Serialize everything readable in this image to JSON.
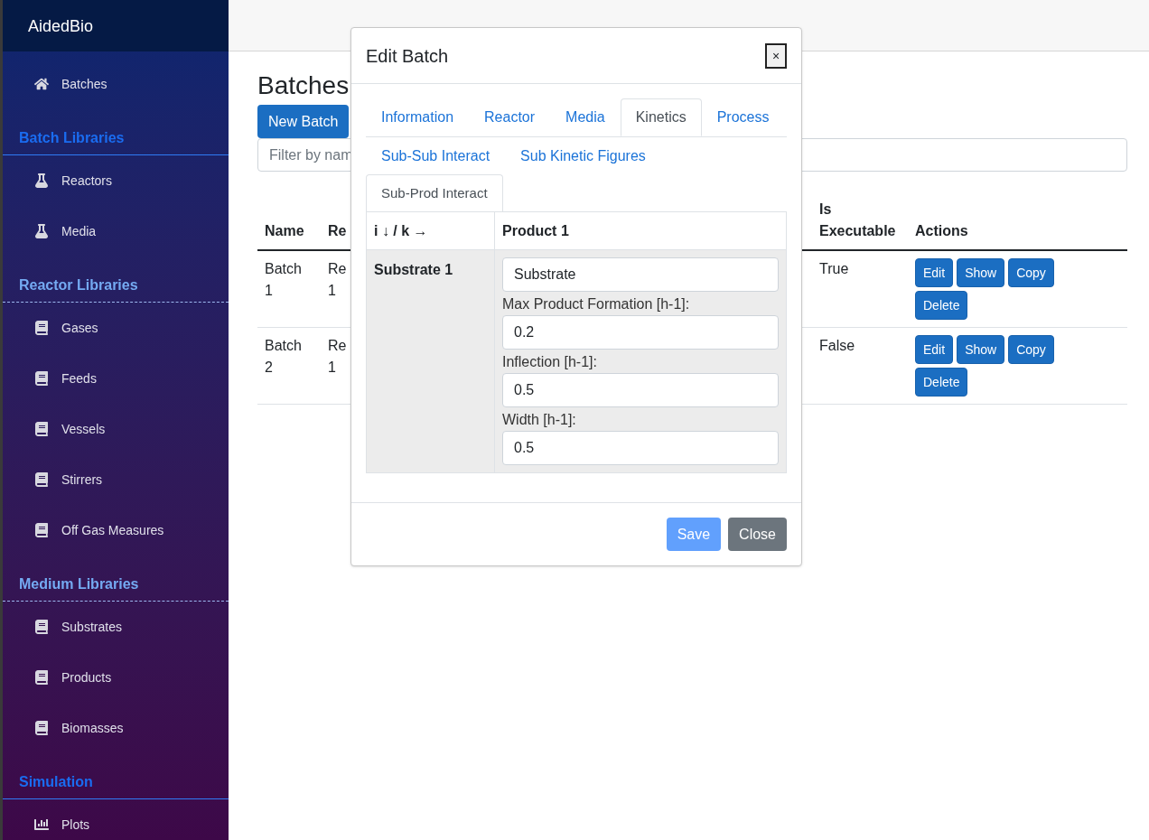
{
  "brand": "AidedBio",
  "sidebar": {
    "items": [
      {
        "kind": "home",
        "label": "Batches"
      },
      {
        "kind": "heading",
        "label": "Batch Libraries",
        "color": "#1a6cf0"
      },
      {
        "kind": "flask",
        "label": "Reactors"
      },
      {
        "kind": "flask",
        "label": "Media"
      },
      {
        "kind": "subheading",
        "label": "Reactor Libraries",
        "color": "#74aaf2"
      },
      {
        "kind": "book",
        "label": "Gases"
      },
      {
        "kind": "book",
        "label": "Feeds"
      },
      {
        "kind": "book",
        "label": "Vessels"
      },
      {
        "kind": "book",
        "label": "Stirrers"
      },
      {
        "kind": "book",
        "label": "Off Gas Measures"
      },
      {
        "kind": "subheading",
        "label": "Medium Libraries",
        "color": "#74aaf2"
      },
      {
        "kind": "book",
        "label": "Substrates"
      },
      {
        "kind": "book",
        "label": "Products"
      },
      {
        "kind": "book",
        "label": "Biomasses"
      },
      {
        "kind": "heading",
        "label": "Simulation",
        "color": "#1a6cf0"
      },
      {
        "kind": "chart",
        "label": "Plots"
      }
    ]
  },
  "page": {
    "title": "Batches",
    "new_button": "New Batch",
    "filter": {
      "placeholder": "Filter by nam"
    },
    "table": {
      "columns": [
        "Name",
        "Re",
        "Is Executable",
        "Actions"
      ],
      "rows": [
        {
          "cells": [
            "Batch 1",
            "Re 1",
            "True"
          ],
          "actions": [
            "Edit",
            "Show",
            "Copy",
            "Delete"
          ]
        },
        {
          "cells": [
            "Batch 2",
            "Re 1",
            "False"
          ],
          "actions": [
            "Edit",
            "Show",
            "Copy",
            "Delete"
          ]
        }
      ]
    }
  },
  "modal": {
    "title": "Edit Batch",
    "close": "×",
    "tabs": [
      {
        "label": "Information",
        "selected": false
      },
      {
        "label": "Reactor",
        "selected": false
      },
      {
        "label": "Media",
        "selected": false
      },
      {
        "label": "Kinetics",
        "selected": true
      },
      {
        "label": "Process",
        "selected": false
      }
    ],
    "sub_tabs": [
      {
        "label": "Sub-Sub Interact",
        "selected": false
      },
      {
        "label": "Sub Kinetic Figures",
        "selected": false
      },
      {
        "label": "Sub-Prod Interact",
        "selected": true
      }
    ],
    "table": {
      "corner": "i ↓ / k →",
      "columns": [
        "Product 1"
      ],
      "rows": [
        {
          "header": "Substrate 1",
          "cells": [
            {
              "select": "Substrate",
              "fields": [
                {
                  "label": "Max Product Formation [h-1]:",
                  "value": "0.2"
                },
                {
                  "label": "Inflection [h-1]:",
                  "value": "0.5"
                },
                {
                  "label": "Width [h-1]:",
                  "value": "0.5"
                }
              ]
            }
          ]
        }
      ]
    },
    "buttons": [
      {
        "kind": "primary",
        "label": "Save",
        "disabled": true
      },
      {
        "kind": "secondary",
        "label": "Close",
        "disabled": false
      }
    ]
  }
}
